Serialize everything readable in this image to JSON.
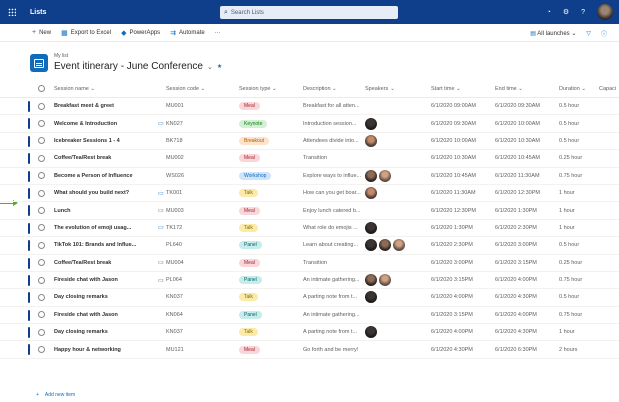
{
  "suitebar": {
    "app_name": "Lists",
    "search_placeholder": "Search Lists",
    "icons": [
      "waffle-icon",
      "search-icon",
      "bell-icon",
      "gear-icon",
      "help-icon",
      "avatar"
    ]
  },
  "commandbar": {
    "new_label": "New",
    "export_label": "Export to Excel",
    "powerapps_label": "PowerApps",
    "automate_label": "Automate",
    "more_label": "···",
    "view_label": "All launches",
    "filter_icon": "filter-icon",
    "info_icon": "info-icon"
  },
  "header": {
    "breadcrumb": "My list",
    "title": "Event itinerary - June Conference",
    "favorite_icon": "star-icon"
  },
  "columns": {
    "session_name": "Session name",
    "session_code": "Session code",
    "session_type": "Session type",
    "description": "Description",
    "speakers": "Speakers",
    "start_time": "Start time",
    "end_time": "End time",
    "duration": "Duration",
    "capacity": "Capaci"
  },
  "rows": [
    {
      "name": "Breakfast meet & greet",
      "comment": false,
      "code": "MU001",
      "type": "Meal",
      "type_bg": "#f9d6d9",
      "type_fg": "#a4262c",
      "desc": "Breakfast for all atten...",
      "speakers": [],
      "start": "6/1/2020 09:00AM",
      "end": "6/1/2020 09:30AM",
      "duration": "0.5 hour"
    },
    {
      "name": "Welcome & Introduction",
      "comment": true,
      "code": "KN027",
      "type": "Keynote",
      "type_bg": "#d2f0d3",
      "type_fg": "#107c10",
      "desc": "Introduction session...",
      "speakers": [
        "c"
      ],
      "start": "6/1/2020 09:30AM",
      "end": "6/1/2020 10:00AM",
      "duration": "0.5 hour"
    },
    {
      "name": "Icebreaker Sessions 1 - 4",
      "comment": false,
      "code": "BK718",
      "type": "Breakout",
      "type_bg": "#fde3c9",
      "type_fg": "#b35b00",
      "desc": "Attendees divide into...",
      "speakers": [
        "b"
      ],
      "start": "6/1/2020 10:00AM",
      "end": "6/1/2020 10:30AM",
      "duration": "0.5 hour"
    },
    {
      "name": "Coffee/Tea/Rest break",
      "comment": false,
      "code": "MU002",
      "type": "Meal",
      "type_bg": "#f9d6d9",
      "type_fg": "#a4262c",
      "desc": "Transition",
      "speakers": [],
      "start": "6/1/2020 10:30AM",
      "end": "6/1/2020 10:45AM",
      "duration": "0.25 hour"
    },
    {
      "name": "Become a Person of Influence",
      "comment": false,
      "code": "WS026",
      "type": "Workshop",
      "type_bg": "#cfe4fa",
      "type_fg": "#0f6cbd",
      "desc": "Explore ways to influe...",
      "speakers": [
        "a",
        "d"
      ],
      "start": "6/1/2020 10:45AM",
      "end": "6/1/2020 11:30AM",
      "duration": "0.75 hour"
    },
    {
      "name": "What should you build next?",
      "comment": true,
      "code": "TK001",
      "type": "Talk",
      "type_bg": "#fbeaa8",
      "type_fg": "#8a6d00",
      "desc": "How can you get boar...",
      "speakers": [
        "b"
      ],
      "start": "6/1/2020 11:30AM",
      "end": "6/1/2020 12:30PM",
      "duration": "1 hour"
    },
    {
      "name": "Lunch",
      "comment": true,
      "code": "MU003",
      "type": "Meal",
      "type_bg": "#f9d6d9",
      "type_fg": "#a4262c",
      "desc": "Enjoy lunch catered b...",
      "speakers": [],
      "start": "6/1/2020 12:30PM",
      "end": "6/1/2020 1:30PM",
      "duration": "1 hour"
    },
    {
      "name": "The evolution of emoji usag...",
      "comment": true,
      "code": "TK172",
      "type": "Talk",
      "type_bg": "#fbeaa8",
      "type_fg": "#8a6d00",
      "desc": "What role do emojis ...",
      "speakers": [
        "c"
      ],
      "start": "6/1/2020 1:30PM",
      "end": "6/1/2020 2:30PM",
      "duration": "1 hour"
    },
    {
      "name": "TikTok 101: Brands and Influe...",
      "comment": false,
      "code": "PL640",
      "type": "Panel",
      "type_bg": "#c7ece9",
      "type_fg": "#00666d",
      "desc": "Learn about creating...",
      "speakers": [
        "c",
        "a",
        "d"
      ],
      "start": "6/1/2020 2:30PM",
      "end": "6/1/2020 3:00PM",
      "duration": "0.5 hour"
    },
    {
      "name": "Coffee/Tea/Rest break",
      "comment": true,
      "code": "MU004",
      "type": "Meal",
      "type_bg": "#f9d6d9",
      "type_fg": "#a4262c",
      "desc": "Transition",
      "speakers": [],
      "start": "6/1/2020 3:00PM",
      "end": "6/1/2020 3:15PM",
      "duration": "0.25 hour"
    },
    {
      "name": "Fireside chat with Jason",
      "comment": true,
      "code": "PL064",
      "type": "Panel",
      "type_bg": "#c7ece9",
      "type_fg": "#00666d",
      "desc": "An intimate gathering...",
      "speakers": [
        "a",
        "d"
      ],
      "start": "6/1/2020 3:15PM",
      "end": "6/1/2020 4:00PM",
      "duration": "0.75 hour"
    },
    {
      "name": "Day closing remarks",
      "comment": false,
      "code": "KN037",
      "type": "Talk",
      "type_bg": "#fbeaa8",
      "type_fg": "#8a6d00",
      "desc": "A parting note from t...",
      "speakers": [
        "c"
      ],
      "start": "6/1/2020 4:00PM",
      "end": "6/1/2020 4:30PM",
      "duration": "0.5 hour"
    },
    {
      "name": "Fireside chat with Jason",
      "comment": false,
      "code": "KN064",
      "type": "Panel",
      "type_bg": "#c7ece9",
      "type_fg": "#00666d",
      "desc": "An intimate gathering...",
      "speakers": [],
      "start": "6/1/2020 3:15PM",
      "end": "6/1/2020 4:00PM",
      "duration": "0.75 hour"
    },
    {
      "name": "Day closing remarks",
      "comment": false,
      "code": "KN037",
      "type": "Talk",
      "type_bg": "#fbeaa8",
      "type_fg": "#8a6d00",
      "desc": "A parting note from t...",
      "speakers": [
        "c"
      ],
      "start": "6/1/2020 4:00PM",
      "end": "6/1/2020 4:30PM",
      "duration": "1 hour"
    },
    {
      "name": "Happy hour & networking",
      "comment": false,
      "code": "MU121",
      "type": "Meal",
      "type_bg": "#f9d6d9",
      "type_fg": "#a4262c",
      "desc": "Go forth and be merry!",
      "speakers": [],
      "start": "6/1/2020 4:30PM",
      "end": "6/1/2020 6:30PM",
      "duration": "2 hours"
    }
  ],
  "footer": {
    "add_new": "Add new item"
  }
}
